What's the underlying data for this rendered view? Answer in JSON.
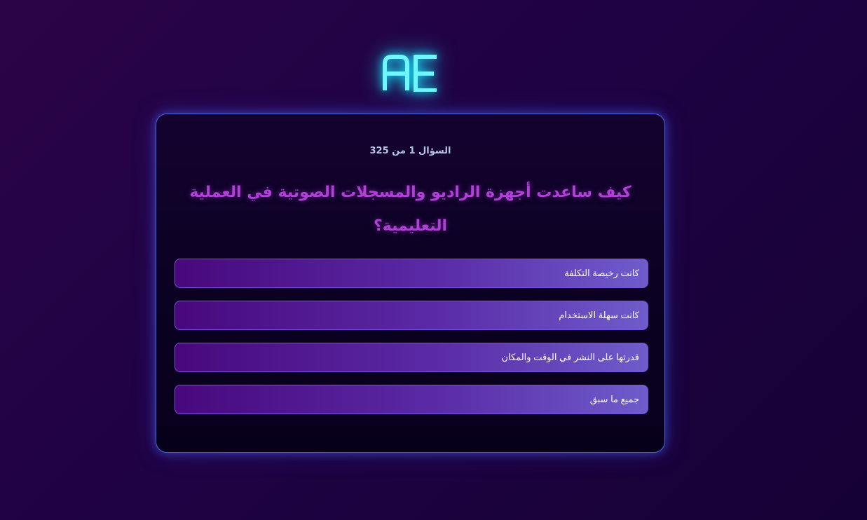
{
  "logo": {
    "text": "AE",
    "color": "#10e8ff"
  },
  "quiz": {
    "progress": "السؤال 1 من 325",
    "question": "كيف ساعدت أجهزة الراديو والمسجلات الصوتية في العملية التعليمية؟",
    "options": [
      {
        "label": "كانت رخيصة التكلفة"
      },
      {
        "label": "كانت سهلة الاستخدام"
      },
      {
        "label": "قدرتها على النشر في الوقت والمكان"
      },
      {
        "label": "جميع ما سبق"
      }
    ]
  },
  "colors": {
    "background": "#22033f",
    "card_border": "#4e63e0",
    "question": "#b040d8",
    "option_start": "#48087c",
    "option_end": "#6f5ccb"
  }
}
